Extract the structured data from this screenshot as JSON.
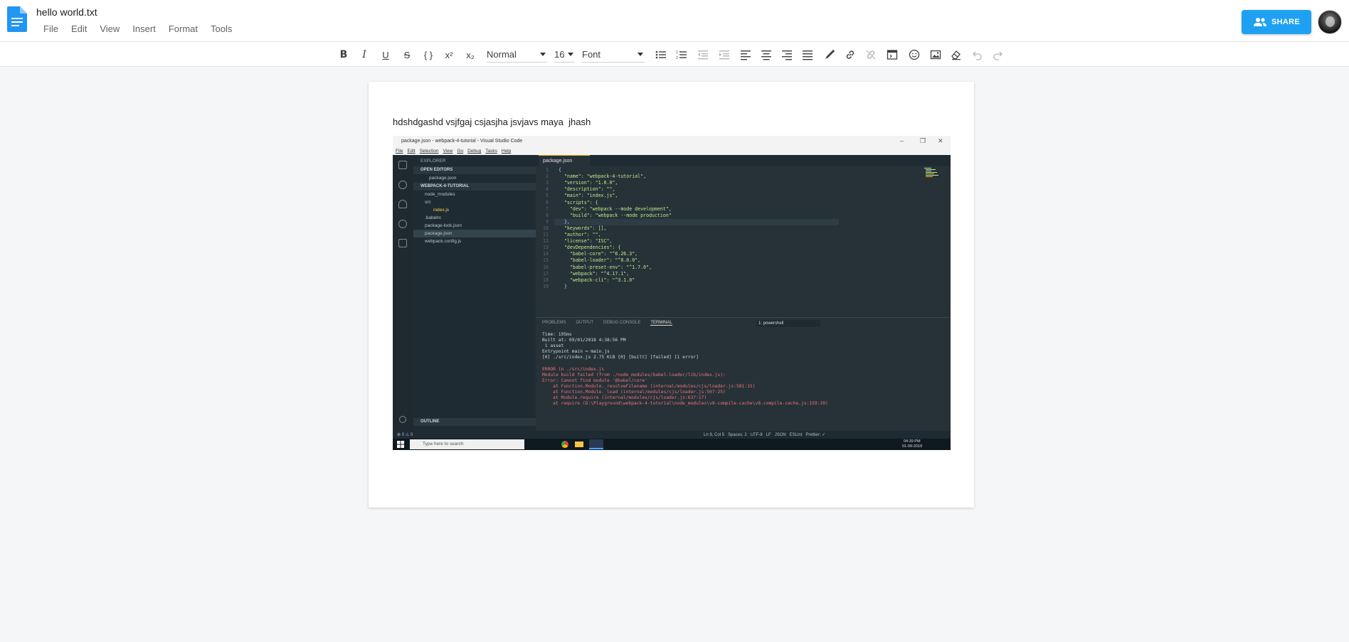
{
  "header": {
    "doc_title": "hello world.txt",
    "menu": [
      "File",
      "Edit",
      "View",
      "Insert",
      "Format",
      "Tools"
    ],
    "share_label": "SHARE"
  },
  "toolbar": {
    "bold": "B",
    "italic": "I",
    "underline": "U",
    "strike": "S",
    "code": "{ }",
    "superscript": "x²",
    "subscript": "x₂",
    "style_value": "Normal",
    "size_value": "16",
    "font_value": "Font"
  },
  "document": {
    "text": "hdshdgashd vsjfgaj csjasjha jsvjavs maya  jhash",
    "embedded_image": {
      "window_title": "package.json - webpack-4-tutorial - Visual Studio Code",
      "menu": [
        "File",
        "Edit",
        "Selection",
        "View",
        "Go",
        "Debug",
        "Tasks",
        "Help"
      ],
      "sidebar": {
        "explorer": "EXPLORER",
        "open_editors": "OPEN EDITORS",
        "open_file": "package.json",
        "project": "WEBPACK-4-TUTORIAL",
        "items": [
          "node_modules",
          "src",
          "index.js",
          ".babelrc",
          "package-lock.json",
          "package.json",
          "webpack.config.js"
        ],
        "outline": "OUTLINE"
      },
      "tab": "package.json",
      "code_lines": [
        "{",
        "  \"name\": \"webpack-4-tutorial\",",
        "  \"version\": \"1.0.0\",",
        "  \"description\": \"\",",
        "  \"main\": \"index.js\",",
        "  \"scripts\": {",
        "    \"dev\": \"webpack --mode development\",",
        "    \"build\": \"webpack --mode production\"",
        "  },",
        "  \"keywords\": [],",
        "  \"author\": \"\",",
        "  \"license\": \"ISC\",",
        "  \"devDependencies\": {",
        "    \"babel-core\": \"^6.26.3\",",
        "    \"babel-loader\": \"^8.0.0\",",
        "    \"babel-preset-env\": \"^1.7.0\",",
        "    \"webpack\": \"^4.17.1\",",
        "    \"webpack-cli\": \"^3.1.0\"",
        "  }"
      ],
      "panel_tabs": [
        "PROBLEMS",
        "OUTPUT",
        "DEBUG CONSOLE",
        "TERMINAL"
      ],
      "terminal_select": "1: powershell",
      "terminal": [
        "Time: 195ms",
        "Built at: 09/01/2018 4:38:56 PM",
        " 1 asset",
        "Entrypoint main = main.js",
        "[0] ./src/index.js 2.75 KiB {0} [built] [failed] [1 error]",
        "",
        "ERROR in ./src/index.js",
        "Module build failed (from ./node_modules/babel-loader/lib/index.js):",
        "Error: Cannot find module '@babel/core'",
        "    at Function.Module._resolveFilename (internal/modules/cjs/loader.js:581:15)",
        "    at Function.Module._load (internal/modules/cjs/loader.js:507:25)",
        "    at Module.require (internal/modules/cjs/loader.js:637:17)",
        "    at require (D:\\Playground\\webpack-4-tutorial\\node_modules\\v8-compile-cache\\v8-compile-cache.js:159:20)"
      ],
      "status_left": "⊗ 0 ⚠ 0",
      "status_right": "Ln 9, Col 5   Spaces: 2   UTF-8   LF   JSON   ESLint   Prettier: ✓",
      "taskbar_search": "Type here to search",
      "clock_time": "04:39 PM",
      "clock_date": "01-09-2018"
    }
  },
  "colors": {
    "share": "#1ea1f2",
    "doc_icon": "#2196f3",
    "progress": "#e53935"
  }
}
